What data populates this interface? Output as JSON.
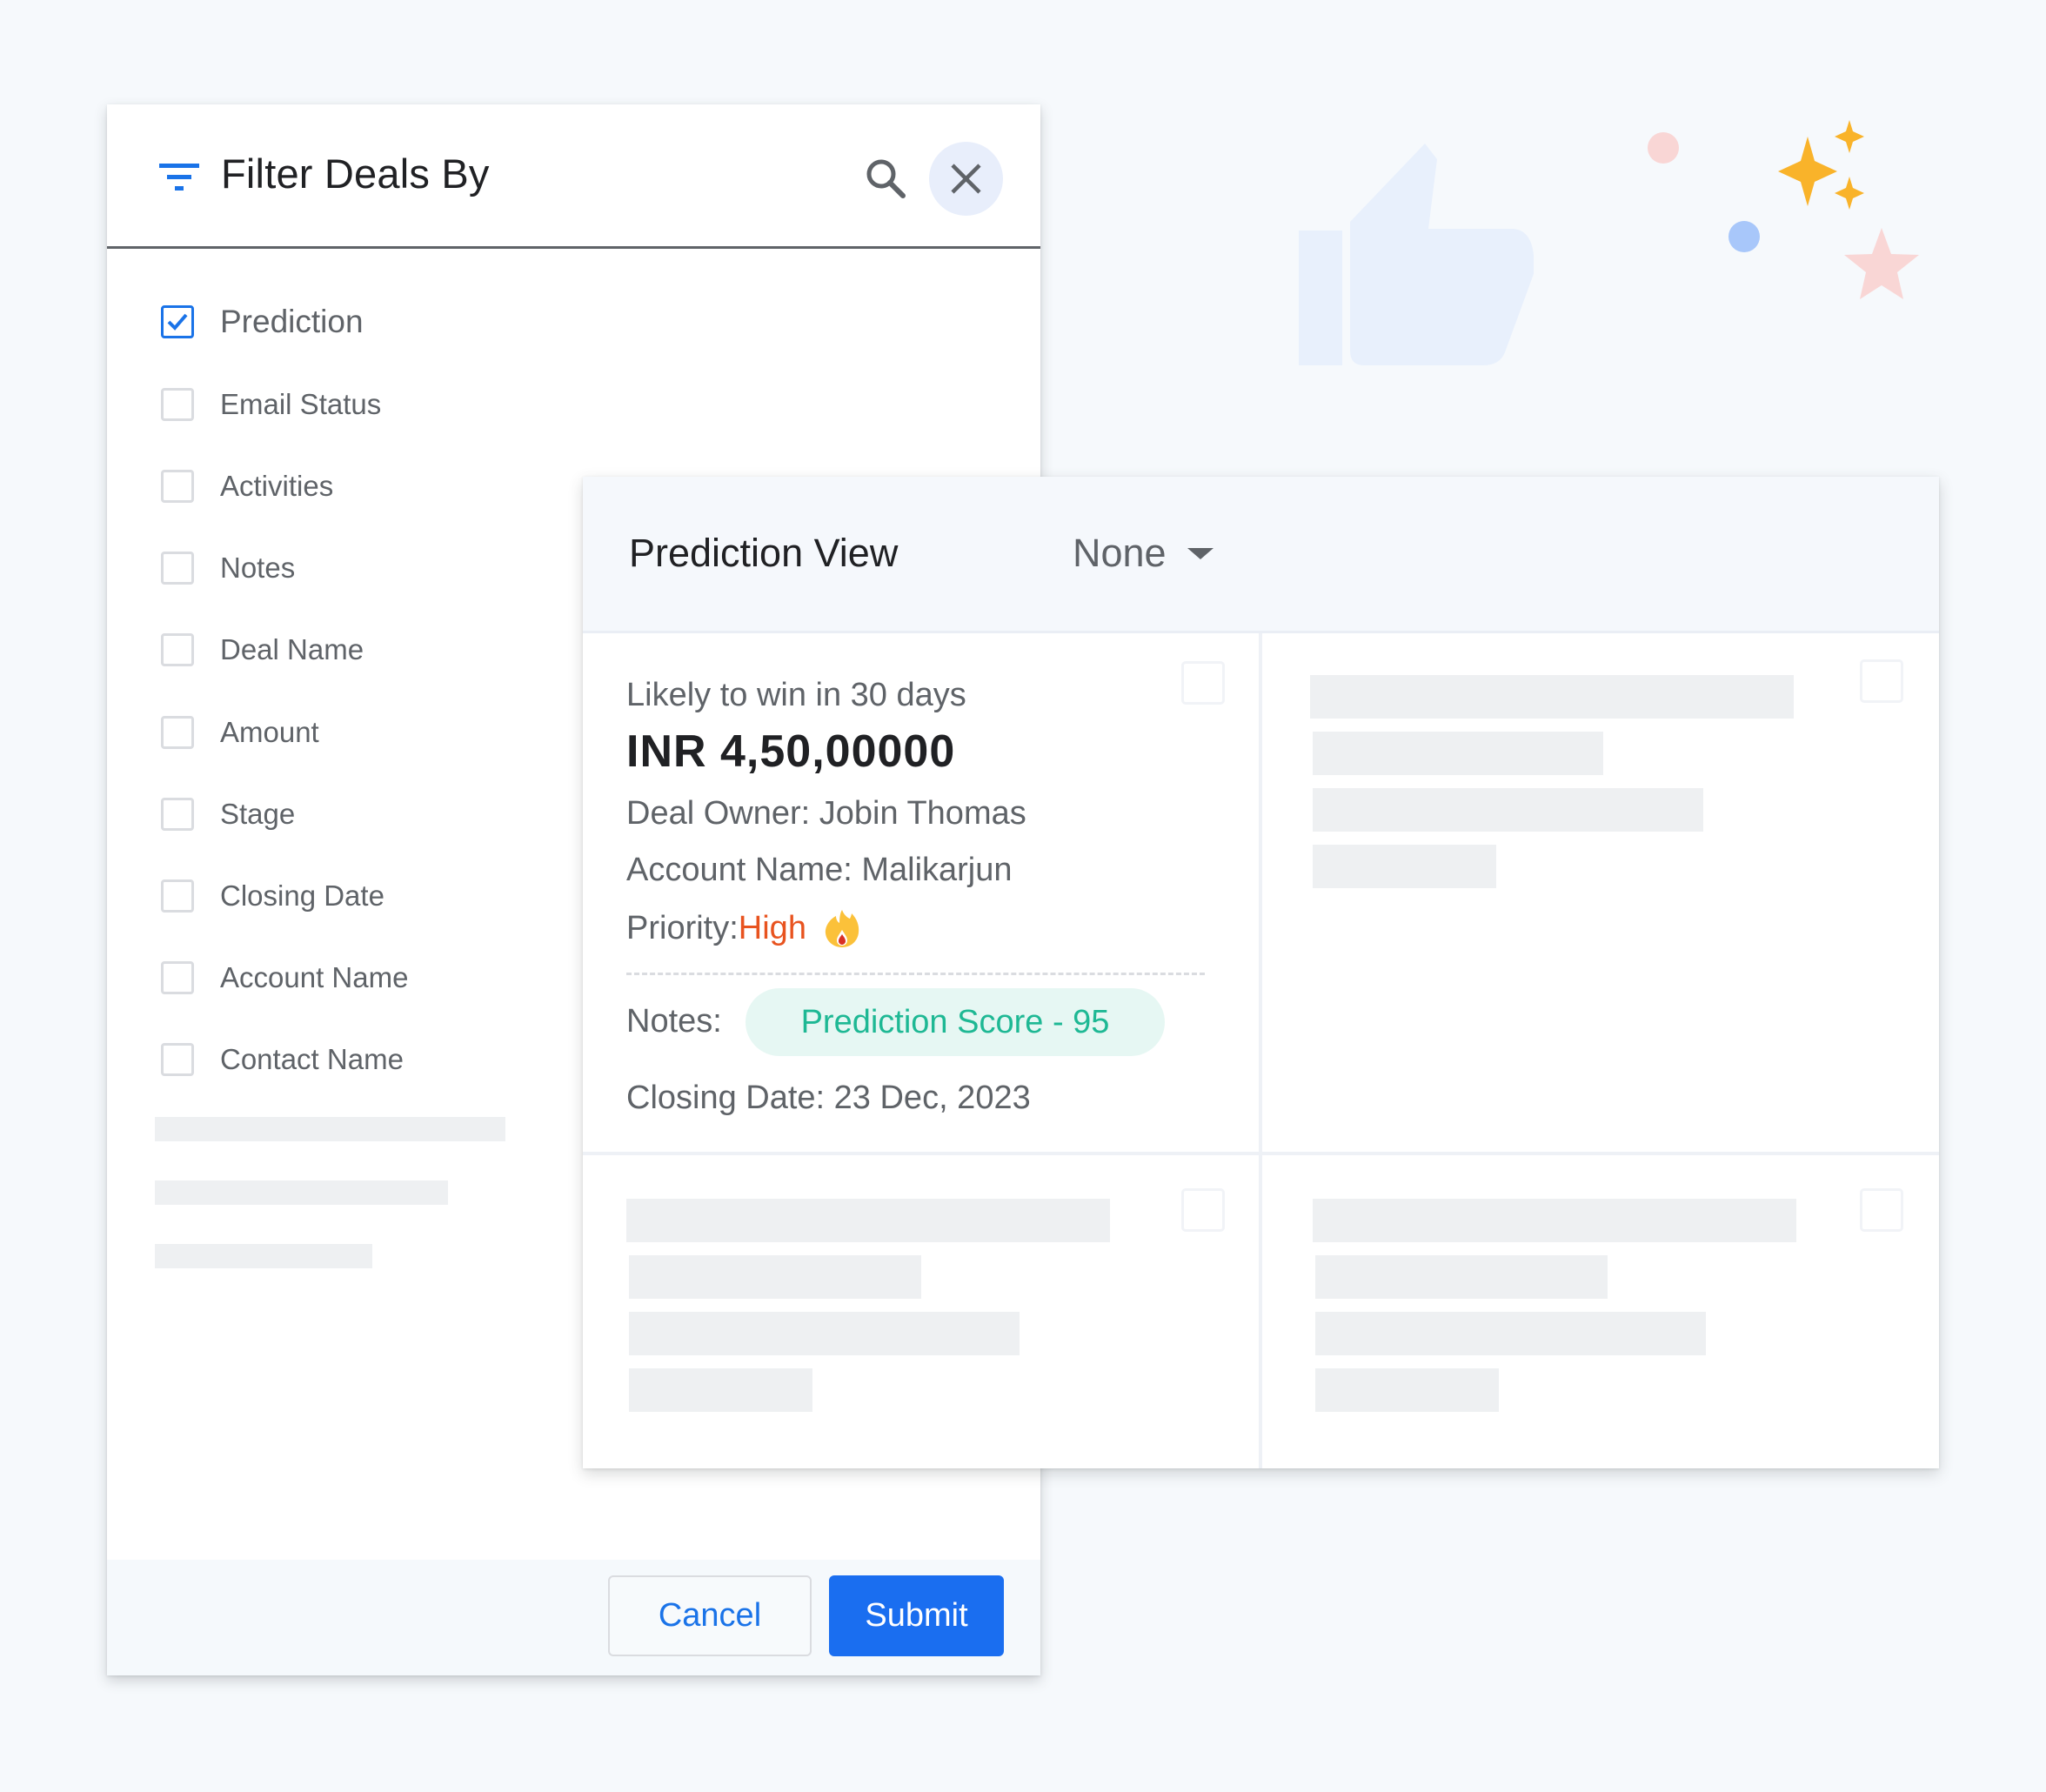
{
  "filter_panel": {
    "title": "Filter Deals By",
    "icons": {
      "filter": "filter-icon",
      "search": "search-icon",
      "close": "close-icon"
    },
    "options": [
      {
        "label": "Prediction",
        "checked": true
      },
      {
        "label": "Email Status",
        "checked": false
      },
      {
        "label": "Activities",
        "checked": false
      },
      {
        "label": "Notes",
        "checked": false
      },
      {
        "label": "Deal Name",
        "checked": false
      },
      {
        "label": "Amount",
        "checked": false
      },
      {
        "label": "Stage",
        "checked": false
      },
      {
        "label": "Closing Date",
        "checked": false
      },
      {
        "label": "Account Name",
        "checked": false
      },
      {
        "label": "Contact Name",
        "checked": false
      }
    ],
    "cancel_label": "Cancel",
    "submit_label": "Submit"
  },
  "prediction_view": {
    "title": "Prediction View",
    "selected_option": "None",
    "deal_card": {
      "likely": "Likely to win in 30 days",
      "amount": "INR 4,50,00000",
      "owner": "Deal Owner: Jobin Thomas",
      "account": "Account Name: Malikarjun",
      "priority_label": "Priority: ",
      "priority_value": "High",
      "priority_icon": "fire-icon",
      "notes_label": "Notes:",
      "score_badge": "Prediction Score - 95",
      "closing": "Closing Date: 23 Dec, 2023"
    }
  },
  "colors": {
    "accent": "#1a73e8",
    "submit_bg": "#1a6ef0",
    "priority_high": "#e8531f",
    "score_text": "#1eb894",
    "score_bg": "#e6f7f3",
    "sparkle": "#f9b32a",
    "star_pink": "#f9d6d5",
    "dot_blue": "#a8c7fa"
  }
}
